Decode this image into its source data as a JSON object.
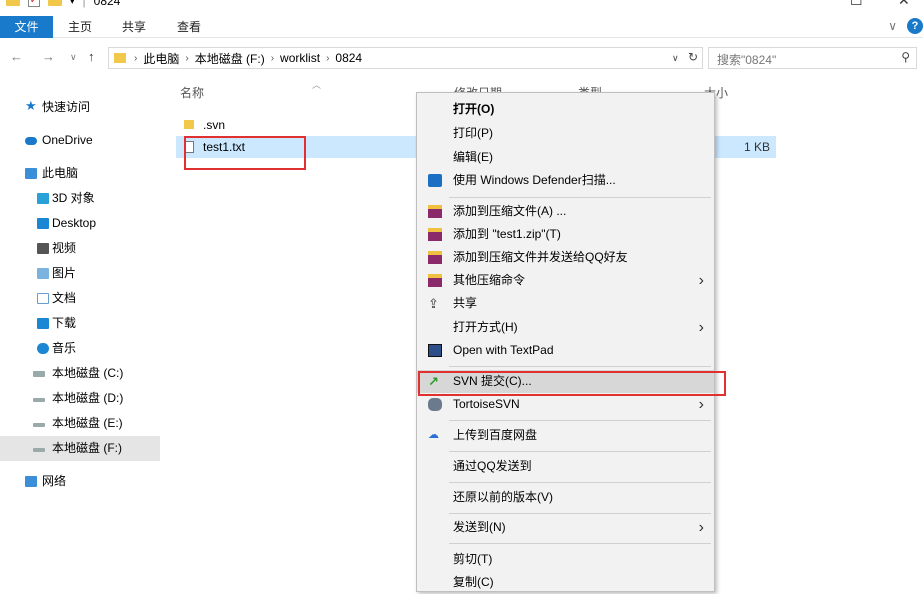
{
  "window": {
    "title_path_fragment": "0824"
  },
  "ribbon": {
    "tabs": [
      "文件",
      "主页",
      "共享",
      "查看"
    ]
  },
  "address": {
    "crumbs": [
      "此电脑",
      "本地磁盘 (F:)",
      "worklist",
      "0824"
    ],
    "search_placeholder": "搜索\"0824\""
  },
  "sidebar": {
    "items": [
      {
        "label": "快速访问",
        "icon": "star-icon"
      },
      {
        "label": "OneDrive",
        "icon": "cloud-icon"
      },
      {
        "label": "此电脑",
        "icon": "computer-icon"
      },
      {
        "label": "3D 对象",
        "icon": "3d-objects-icon"
      },
      {
        "label": "Desktop",
        "icon": "desktop-icon"
      },
      {
        "label": "视频",
        "icon": "video-icon"
      },
      {
        "label": "图片",
        "icon": "pictures-icon"
      },
      {
        "label": "文档",
        "icon": "documents-icon"
      },
      {
        "label": "下载",
        "icon": "downloads-icon"
      },
      {
        "label": "音乐",
        "icon": "music-icon"
      },
      {
        "label": "本地磁盘 (C:)",
        "icon": "drive-icon"
      },
      {
        "label": "本地磁盘 (D:)",
        "icon": "drive-icon"
      },
      {
        "label": "本地磁盘 (E:)",
        "icon": "drive-icon"
      },
      {
        "label": "本地磁盘 (F:)",
        "icon": "drive-icon"
      },
      {
        "label": "网络",
        "icon": "network-icon"
      }
    ]
  },
  "filelist": {
    "headers": {
      "name": "名称",
      "modified": "修改日期",
      "type": "类型",
      "size": "大小"
    },
    "rows": [
      {
        "name": ".svn",
        "size": "",
        "icon": "folder-icon"
      },
      {
        "name": "test1.txt",
        "size": "1 KB",
        "icon": "text-file-icon"
      }
    ]
  },
  "context_menu": {
    "items": [
      {
        "label": "打开(O)"
      },
      {
        "label": "打印(P)"
      },
      {
        "label": "编辑(E)"
      },
      {
        "label": "使用 Windows Defender扫描..."
      },
      {
        "label": "添加到压缩文件(A) ..."
      },
      {
        "label": "添加到 \"test1.zip\"(T)"
      },
      {
        "label": "添加到压缩文件并发送给QQ好友"
      },
      {
        "label": "其他压缩命令"
      },
      {
        "label": "共享"
      },
      {
        "label": "打开方式(H)"
      },
      {
        "label": "Open with TextPad"
      },
      {
        "label": "SVN 提交(C)..."
      },
      {
        "label": "TortoiseSVN"
      },
      {
        "label": "上传到百度网盘"
      },
      {
        "label": "通过QQ发送到"
      },
      {
        "label": "还原以前的版本(V)"
      },
      {
        "label": "发送到(N)"
      },
      {
        "label": "剪切(T)"
      },
      {
        "label": "复制(C)"
      }
    ]
  },
  "colors": {
    "accent": "#1979ca",
    "selection": "#cce8ff",
    "highlight_box": "#e03030"
  }
}
